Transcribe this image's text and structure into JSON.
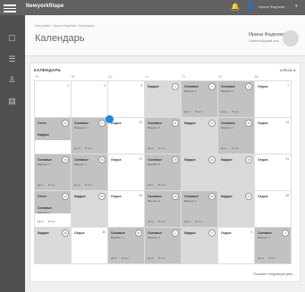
{
  "app": {
    "logo": "Newyorkfitape"
  },
  "topbar": {
    "bell_icon": "bell-icon",
    "user_icon": "user-icon",
    "username": "Ирина Фадеева",
    "chevron": "chevron-down-icon"
  },
  "header": {
    "breadcrumb": "Настройки › Ирина Фадеева › Календарь",
    "title": "Календарь",
    "user_name": "Ирина Фадеева",
    "user_email": "i.fadeeva@gmail.com"
  },
  "calendar": {
    "title": "КАЛЕНДАРЬ",
    "nav_prev": "◂",
    "nav_label": "Июль",
    "nav_next": "▸",
    "weekdays": [
      "Пн",
      "Вт",
      "Ср",
      "Чт",
      "Пт",
      "Сб",
      "Вс"
    ],
    "button_done": "Дело",
    "button_task": "В зал",
    "show_more": "Показать следующую дату"
  },
  "cells": {
    "c01": {
      "num": "1"
    },
    "c02": {
      "num": "2"
    },
    "c03": {
      "num": "3"
    },
    "c04": {
      "label": "Кардио",
      "num": "4"
    },
    "c05": {
      "label": "Силовые",
      "sub": "Вариант 1",
      "num": "5"
    },
    "c06": {
      "label": "Силовые",
      "sub": "Вариант 2",
      "num": "6"
    },
    "c07": {
      "label": "Отдых",
      "num": "7"
    },
    "c08": {
      "label": "Отчет",
      "label2": "Кардио",
      "num": "8"
    },
    "c09": {
      "label": "Силовые",
      "sub": "Вариант 1",
      "num": "9"
    },
    "c10": {
      "label": "Отдых",
      "num": "10"
    },
    "c11": {
      "label": "Силовые",
      "sub": "Вариант 2",
      "num": "11"
    },
    "c12": {
      "label": "Кардио",
      "num": "12"
    },
    "c13": {
      "label": "Силовые",
      "sub": "Вариант 1",
      "num": "13"
    },
    "c14": {
      "label": "Отдых",
      "num": "14"
    },
    "c15": {
      "label": "Силовые",
      "sub": "Вариант 2",
      "num": "15"
    },
    "c16": {
      "label": "Силовые",
      "sub": "Вариант 1",
      "num": "16"
    },
    "c17": {
      "label": "Отдых",
      "num": "17"
    },
    "c18": {
      "label": "Силовые",
      "sub": "Вариант 2",
      "num": "18"
    },
    "c19": {
      "label": "Кардио",
      "num": "19"
    },
    "c20": {
      "label": "Кардио",
      "num": "20"
    },
    "c21": {
      "label": "Отдых",
      "num": "21"
    },
    "c22": {
      "label": "Отчет",
      "label2": "Силовые",
      "sub2": "Вариант 1",
      "num": "22"
    },
    "c23": {
      "label": "Кардио",
      "num": "23"
    },
    "c24": {
      "label": "Отдых",
      "num": "24"
    },
    "c25": {
      "label": "Силовые",
      "sub": "Вариант 2",
      "num": "25"
    },
    "c26": {
      "label": "Силовые",
      "sub": "Вариант 1",
      "num": "26"
    },
    "c27": {
      "label": "Кардио",
      "num": "27"
    },
    "c28": {
      "label": "Отдых",
      "num": "28"
    },
    "c29": {
      "label": "Кардио",
      "num": "29"
    },
    "c30": {
      "label": "Отдых",
      "num": "30"
    },
    "c31": {
      "label": "Силовые",
      "sub": "Вариант 1",
      "num": "31"
    },
    "c32": {
      "label": "Силовые",
      "sub": "Вариант 2",
      "num": "1"
    },
    "c33": {
      "label": "Кардио",
      "num": "2"
    },
    "c34": {
      "label": "Отдых",
      "num": "3"
    },
    "c35": {
      "label": "Силовые",
      "sub": "Вариант 1",
      "num": "4"
    }
  },
  "today_marker": "5"
}
